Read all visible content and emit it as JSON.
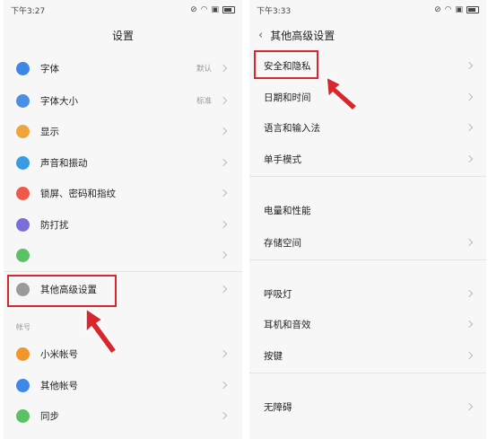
{
  "left": {
    "status_time": "下午3:27",
    "title": "设置",
    "items": [
      {
        "label": "字体",
        "value": "默认",
        "icon": "font-icon",
        "color": "#3f86e9"
      },
      {
        "label": "字体大小",
        "value": "标准",
        "icon": "font-size-icon",
        "color": "#4a8fe3"
      },
      {
        "label": "显示",
        "value": "",
        "icon": "display-icon",
        "color": "#f0a43a"
      },
      {
        "label": "声音和振动",
        "value": "",
        "icon": "sound-icon",
        "color": "#3c9be0"
      },
      {
        "label": "锁屏、密码和指纹",
        "value": "",
        "icon": "lock-icon",
        "color": "#ee5a4a"
      },
      {
        "label": "防打扰",
        "value": "",
        "icon": "moon-icon",
        "color": "#7a6fd9"
      },
      {
        "label": "",
        "value": "",
        "icon": "partial-icon",
        "color": "#5cc064"
      },
      {
        "label": "其他高级设置",
        "value": "",
        "icon": "more-icon",
        "color": "#9a9a9a"
      }
    ],
    "section_label": "帐号",
    "account_items": [
      {
        "label": "小米帐号",
        "icon": "mi-account-icon",
        "color": "#f3962a"
      },
      {
        "label": "其他帐号",
        "icon": "user-icon",
        "color": "#3f86e9"
      },
      {
        "label": "同步",
        "icon": "sync-icon",
        "color": "#5cc064"
      }
    ]
  },
  "right": {
    "status_time": "下午3:33",
    "title": "其他高级设置",
    "items": [
      {
        "label": "安全和隐私",
        "chevron": true
      },
      {
        "label": "日期和时间",
        "chevron": true
      },
      {
        "label": "语言和输入法",
        "chevron": true
      },
      {
        "label": "单手模式",
        "chevron": true
      },
      {
        "label": "电量和性能",
        "chevron": false
      },
      {
        "label": "存储空间",
        "chevron": true
      },
      {
        "label": "呼吸灯",
        "chevron": true
      },
      {
        "label": "耳机和音效",
        "chevron": true
      },
      {
        "label": "按键",
        "chevron": true
      },
      {
        "label": "无障碍",
        "chevron": true
      }
    ]
  },
  "colors": {
    "highlight": "#d9262c"
  }
}
